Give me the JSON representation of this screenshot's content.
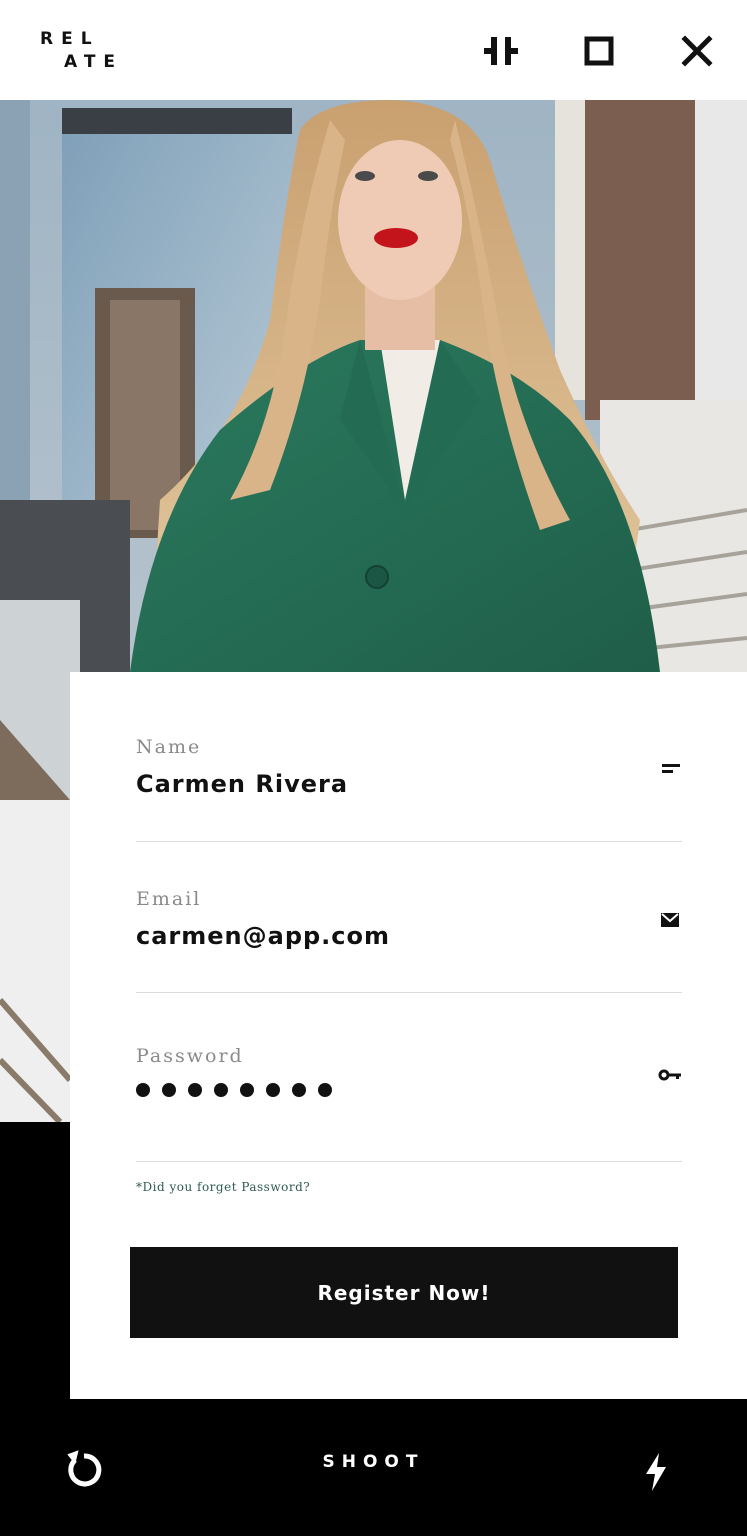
{
  "app": {
    "logo_line1": "REL",
    "logo_line2": "ATE"
  },
  "header": {
    "icons": [
      "adjust-icon",
      "maximize-icon",
      "close-icon"
    ]
  },
  "form": {
    "name": {
      "label": "Name",
      "value": "Carmen Rivera",
      "icon": "lines-icon"
    },
    "email": {
      "label": "Email",
      "value": "carmen@app.com",
      "icon": "mail-icon"
    },
    "password": {
      "label": "Password",
      "masked_length": 8,
      "icon": "key-icon"
    },
    "forgot_label": "*Did you forget Password?",
    "register_label": "Register Now!"
  },
  "bottom": {
    "shoot_label": "SHOOT",
    "icons": [
      "refresh-icon",
      "flash-icon"
    ]
  },
  "colors": {
    "background": "#000000",
    "card": "#ffffff",
    "button": "#111111",
    "coat": "#2e7a60",
    "link": "#2f5a52"
  }
}
